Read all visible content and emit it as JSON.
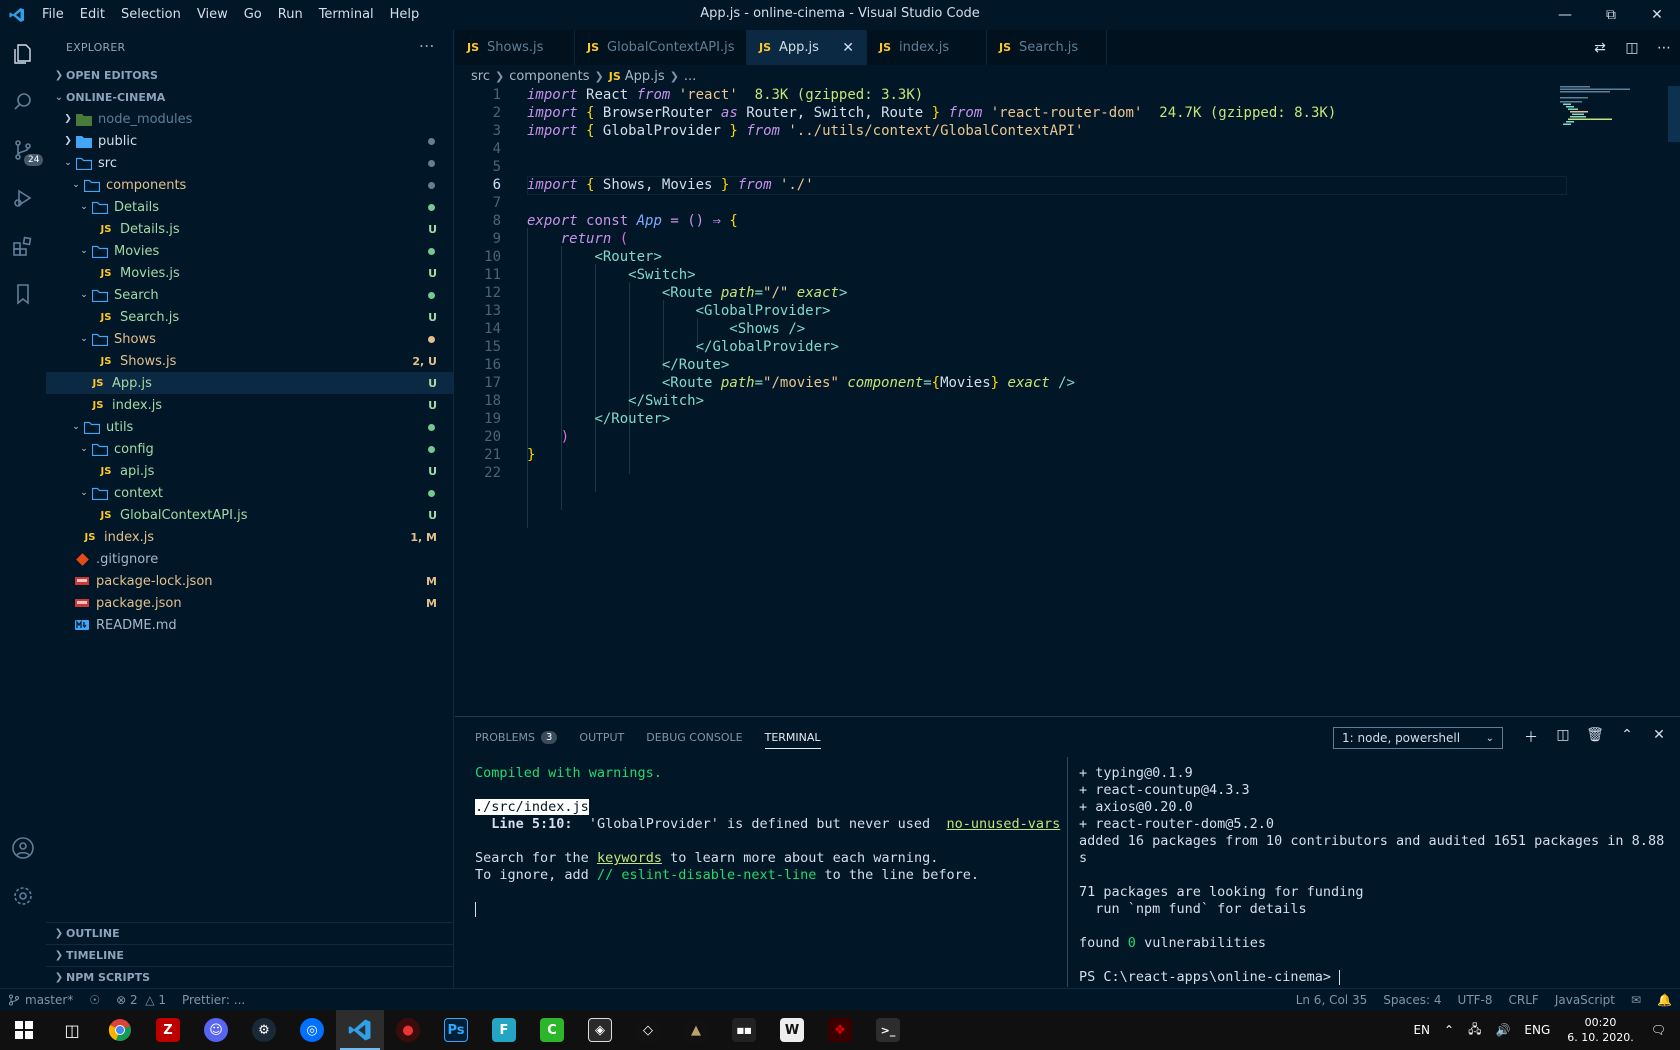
{
  "window": {
    "title": "App.js - online-cinema - Visual Studio Code",
    "menu": [
      "File",
      "Edit",
      "Selection",
      "View",
      "Go",
      "Run",
      "Terminal",
      "Help"
    ]
  },
  "activity": {
    "scm_badge": "24"
  },
  "sidebar": {
    "title": "EXPLORER",
    "open_editors": "OPEN EDITORS",
    "project": "ONLINE-CINEMA",
    "tree": [
      {
        "name": "node_modules",
        "type": "folder",
        "status": ""
      },
      {
        "name": "public",
        "type": "folder",
        "status": ""
      },
      {
        "name": "src",
        "type": "folder",
        "status": ""
      },
      {
        "name": "components",
        "type": "folder",
        "status": ""
      },
      {
        "name": "Details",
        "type": "folder",
        "status": ""
      },
      {
        "name": "Details.js",
        "type": "js",
        "status": "U"
      },
      {
        "name": "Movies",
        "type": "folder",
        "status": ""
      },
      {
        "name": "Movies.js",
        "type": "js",
        "status": "U"
      },
      {
        "name": "Search",
        "type": "folder",
        "status": ""
      },
      {
        "name": "Search.js",
        "type": "js",
        "status": "U"
      },
      {
        "name": "Shows",
        "type": "folder",
        "status": ""
      },
      {
        "name": "Shows.js",
        "type": "js",
        "status": "2, U"
      },
      {
        "name": "App.js",
        "type": "js",
        "status": "U"
      },
      {
        "name": "index.js",
        "type": "js",
        "status": "U"
      },
      {
        "name": "utils",
        "type": "folder",
        "status": ""
      },
      {
        "name": "config",
        "type": "folder",
        "status": ""
      },
      {
        "name": "api.js",
        "type": "js",
        "status": "U"
      },
      {
        "name": "context",
        "type": "folder",
        "status": ""
      },
      {
        "name": "GlobalContextAPI.js",
        "type": "js",
        "status": "U"
      },
      {
        "name": "index.js",
        "type": "js",
        "status": "1, M"
      },
      {
        "name": ".gitignore",
        "type": "git",
        "status": ""
      },
      {
        "name": "package-lock.json",
        "type": "json",
        "status": "M"
      },
      {
        "name": "package.json",
        "type": "json",
        "status": "M"
      },
      {
        "name": "README.md",
        "type": "md",
        "status": ""
      }
    ],
    "outline": "OUTLINE",
    "timeline": "TIMELINE",
    "npm_scripts": "NPM SCRIPTS"
  },
  "tabs": [
    {
      "label": "Shows.js",
      "active": false
    },
    {
      "label": "GlobalContextAPI.js",
      "active": false
    },
    {
      "label": "App.js",
      "active": true
    },
    {
      "label": "index.js",
      "active": false
    },
    {
      "label": "Search.js",
      "active": false
    }
  ],
  "tab_badge": "JS",
  "breadcrumb": [
    "src",
    "components",
    "App.js",
    "..."
  ],
  "editor": {
    "line_numbers": [
      "1",
      "2",
      "3",
      "4",
      "5",
      "6",
      "7",
      "8",
      "9",
      "10",
      "11",
      "12",
      "13",
      "14",
      "15",
      "16",
      "17",
      "18",
      "19",
      "20",
      "21",
      "22"
    ],
    "code": {
      "l1_import": "import",
      "l1_name": "React",
      "l1_from": "from",
      "l1_mod": "'react'",
      "l1_size": "8.3K (gzipped: 3.3K)",
      "l2_import": "import",
      "l2_names_a": "BrowserRouter",
      "l2_as": "as",
      "l2_names_b": "Router, Switch, Route",
      "l2_from": "from",
      "l2_mod": "'react-router-dom'",
      "l2_size": "24.7K (gzipped: 8.3K)",
      "l3_import": "import",
      "l3_name": "GlobalProvider",
      "l3_from": "from",
      "l3_mod": "'../utils/context/GlobalContextAPI'",
      "l6_import": "import",
      "l6_names": "Shows, Movies",
      "l6_from": "from",
      "l6_mod": "'./'",
      "l8_export": "export",
      "l8_const": "const",
      "l8_name": "App",
      "l8_arrow": "= () ⇒",
      "l9_return": "return",
      "l10_tag": "Router",
      "l11_tag": "Switch",
      "l12_tag": "Route",
      "l12_attr": "path",
      "l12_val": "\"/\"",
      "l12_exact": "exact",
      "l13_tag": "GlobalProvider",
      "l14_tag": "Shows",
      "l15_tag": "GlobalProvider",
      "l16_tag": "Route",
      "l17_tag": "Route",
      "l17_attr": "path",
      "l17_val": "\"/movies\"",
      "l17_comp": "component",
      "l17_compval": "Movies",
      "l17_exact": "exact",
      "l18_tag": "Switch",
      "l19_tag": "Router"
    }
  },
  "panel": {
    "tabs": [
      "PROBLEMS",
      "OUTPUT",
      "DEBUG CONSOLE",
      "TERMINAL"
    ],
    "problems_count": "3",
    "terminal_select": "1: node, powershell",
    "left": {
      "compiled": "Compiled with warnings.",
      "file": "./src/index.js",
      "warn_pos": "Line 5:10:",
      "warn_msg": "'GlobalProvider' is defined but never used",
      "warn_rule": "no-unused-vars",
      "search_a": "Search for the",
      "search_link": "keywords",
      "search_b": "to learn more about each warning.",
      "ignore_a": "To ignore, add",
      "ignore_code": "// eslint-disable-next-line",
      "ignore_b": "to the line before."
    },
    "right": {
      "lines": [
        "+ typing@0.1.9",
        "+ react-countup@4.3.3",
        "+ axios@0.20.0",
        "+ react-router-dom@5.2.0",
        "added 16 packages from 10 contributors and audited 1651 packages in 8.88",
        "s"
      ],
      "funding1": "71 packages are looking for funding",
      "funding2": "  run `npm fund` for details",
      "found_a": "found",
      "found_num": "0",
      "found_b": "vulnerabilities",
      "prompt": "PS C:\\react-apps\\online-cinema>"
    }
  },
  "status": {
    "branch": "master*",
    "errors": "2",
    "warnings": "1",
    "prettier": "Prettier: ...",
    "position": "Ln 6, Col 35",
    "spaces": "Spaces: 4",
    "encoding": "UTF-8",
    "eol": "CRLF",
    "language": "JavaScript"
  },
  "taskbar": {
    "lang": "EN",
    "keyboard": "ENG",
    "time": "00:20",
    "date": "6. 10. 2020."
  }
}
